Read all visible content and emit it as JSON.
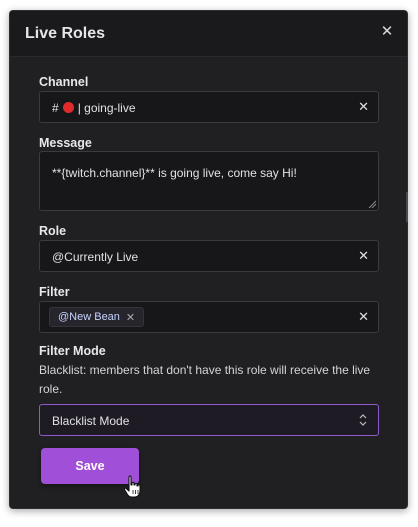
{
  "dialog": {
    "title": "Live Roles",
    "close_icon": "close-icon"
  },
  "channel": {
    "label": "Channel",
    "value_prefix": "#",
    "status_color": "#e12b2b",
    "value": "| going-live",
    "clear_icon": "close-icon"
  },
  "message": {
    "label": "Message",
    "value": "**{twitch.channel}** is going live, come say Hi!"
  },
  "role": {
    "label": "Role",
    "value": "@Currently Live",
    "clear_icon": "close-icon"
  },
  "filter": {
    "label": "Filter",
    "chips": [
      {
        "label": "@New Bean"
      }
    ],
    "clear_icon": "close-icon"
  },
  "filter_mode": {
    "label": "Filter Mode",
    "description": "Blacklist: members that don't have this role will receive the live role.",
    "selected": "Blacklist Mode",
    "accent": "#8d5cc9"
  },
  "actions": {
    "save_label": "Save",
    "save_color": "#a04fd8"
  }
}
